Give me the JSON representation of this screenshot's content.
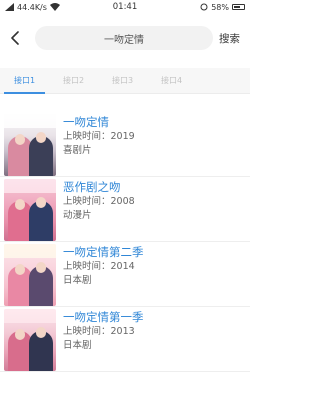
{
  "status": {
    "network": "44.4K/s",
    "time": "01:41",
    "battery": "58%"
  },
  "header": {
    "search_value": "一吻定情",
    "search_label": "搜索"
  },
  "tabs": [
    {
      "label": "接口1"
    },
    {
      "label": "接口2"
    },
    {
      "label": "接口3"
    },
    {
      "label": "接口4"
    }
  ],
  "results": [
    {
      "title": "一吻定情",
      "date": "上映时间：2019",
      "genre": "喜剧片"
    },
    {
      "title": "恶作剧之吻",
      "date": "上映时间：2008",
      "genre": "动漫片"
    },
    {
      "title": "一吻定情第二季",
      "date": "上映时间：2014",
      "genre": "日本剧"
    },
    {
      "title": "一吻定情第一季",
      "date": "上映时间：2013",
      "genre": "日本剧"
    }
  ],
  "colors": {
    "accent": "#3d8fe0",
    "title": "#2f86d6"
  }
}
